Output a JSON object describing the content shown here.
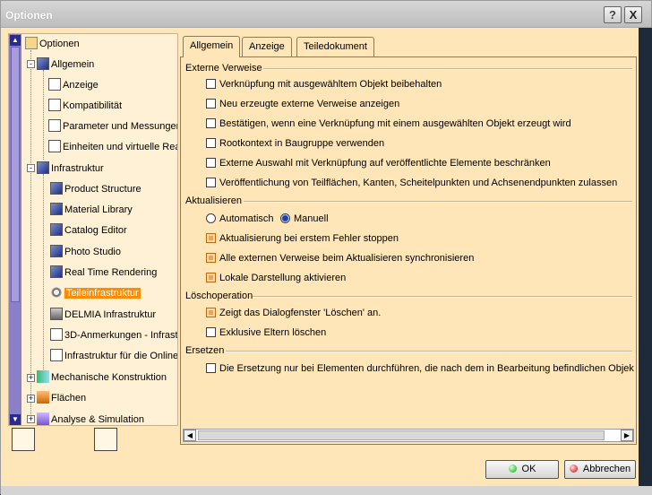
{
  "window": {
    "title": "Optionen"
  },
  "titlebar": {
    "help": "?",
    "close": "X"
  },
  "tree": {
    "items": [
      {
        "label": "Optionen",
        "icon": "root-icon"
      },
      {
        "label": "Allgemein",
        "icon": "cube-icon"
      },
      {
        "label": "Anzeige",
        "icon": "sheet-icon"
      },
      {
        "label": "Kompatibilität",
        "icon": "sheet-icon"
      },
      {
        "label": "Parameter und Messungen",
        "icon": "sheet-icon"
      },
      {
        "label": "Einheiten und virtuelle Rea",
        "icon": "sheet-icon"
      },
      {
        "label": "Infrastruktur",
        "icon": "cube-icon"
      },
      {
        "label": "Product Structure",
        "icon": "cube-icon"
      },
      {
        "label": "Material Library",
        "icon": "cube-icon"
      },
      {
        "label": "Catalog Editor",
        "icon": "cube-icon"
      },
      {
        "label": "Photo Studio",
        "icon": "cube-icon"
      },
      {
        "label": "Real Time Rendering",
        "icon": "cube-icon"
      },
      {
        "label": "Teileinfrastruktur",
        "icon": "gear-icon"
      },
      {
        "label": "DELMIA Infrastruktur",
        "icon": "gray-icon"
      },
      {
        "label": "3D-Anmerkungen - Infrast",
        "icon": "sheet-icon"
      },
      {
        "label": "Infrastruktur für die Online",
        "icon": "sheet-icon"
      },
      {
        "label": "Mechanische Konstruktion",
        "icon": "arrow-icon"
      },
      {
        "label": "Flächen",
        "icon": "orange-icon"
      },
      {
        "label": "Analyse & Simulation",
        "icon": "purple-icon"
      }
    ]
  },
  "tabs": [
    {
      "label": "Allgemein"
    },
    {
      "label": "Anzeige"
    },
    {
      "label": "Teiledokument"
    }
  ],
  "sections": {
    "externe": {
      "title": "Externe Verweise",
      "options": [
        {
          "label": "Verknüpfung mit ausgewähltem Objekt beibehalten",
          "checked": false
        },
        {
          "label": "Neu erzeugte externe Verweise anzeigen",
          "checked": false
        },
        {
          "label": "Bestätigen, wenn eine Verknüpfung mit einem ausgewählten Objekt erzeugt wird",
          "checked": false
        },
        {
          "label": "Rootkontext in Baugruppe verwenden",
          "checked": false
        },
        {
          "label": "Externe Auswahl mit Verknüpfung auf veröffentlichte Elemente beschränken",
          "checked": false
        },
        {
          "label": "Veröffentlichung von Teilflächen, Kanten, Scheitelpunkten und Achsenendpunkten zulassen",
          "checked": false
        }
      ]
    },
    "aktualisieren": {
      "title": "Aktualisieren",
      "radio_auto": "Automatisch",
      "radio_manual": "Manuell",
      "options": [
        {
          "label": "Aktualisierung bei erstem Fehler stoppen",
          "checked": true
        },
        {
          "label": "Alle externen Verweise beim Aktualisieren synchronisieren",
          "checked": true
        },
        {
          "label": "Lokale Darstellung aktivieren",
          "checked": true
        }
      ]
    },
    "loesch": {
      "title": "Löschoperation",
      "options": [
        {
          "label": "Zeigt das Dialogfenster 'Löschen' an.",
          "checked": true
        },
        {
          "label": "Exklusive Eltern löschen",
          "checked": false
        }
      ]
    },
    "ersetzen": {
      "title": "Ersetzen",
      "options": [
        {
          "label": "Die Ersetzung nur bei Elementen durchführen, die nach dem in Bearbeitung befindlichen Objekt p",
          "checked": false
        }
      ]
    }
  },
  "buttons": {
    "ok": "OK",
    "cancel": "Abbrechen"
  },
  "colors": {
    "panel_bg": "#ffe6b8",
    "selected": "#ff8c00",
    "checked": "#f4a24a"
  }
}
